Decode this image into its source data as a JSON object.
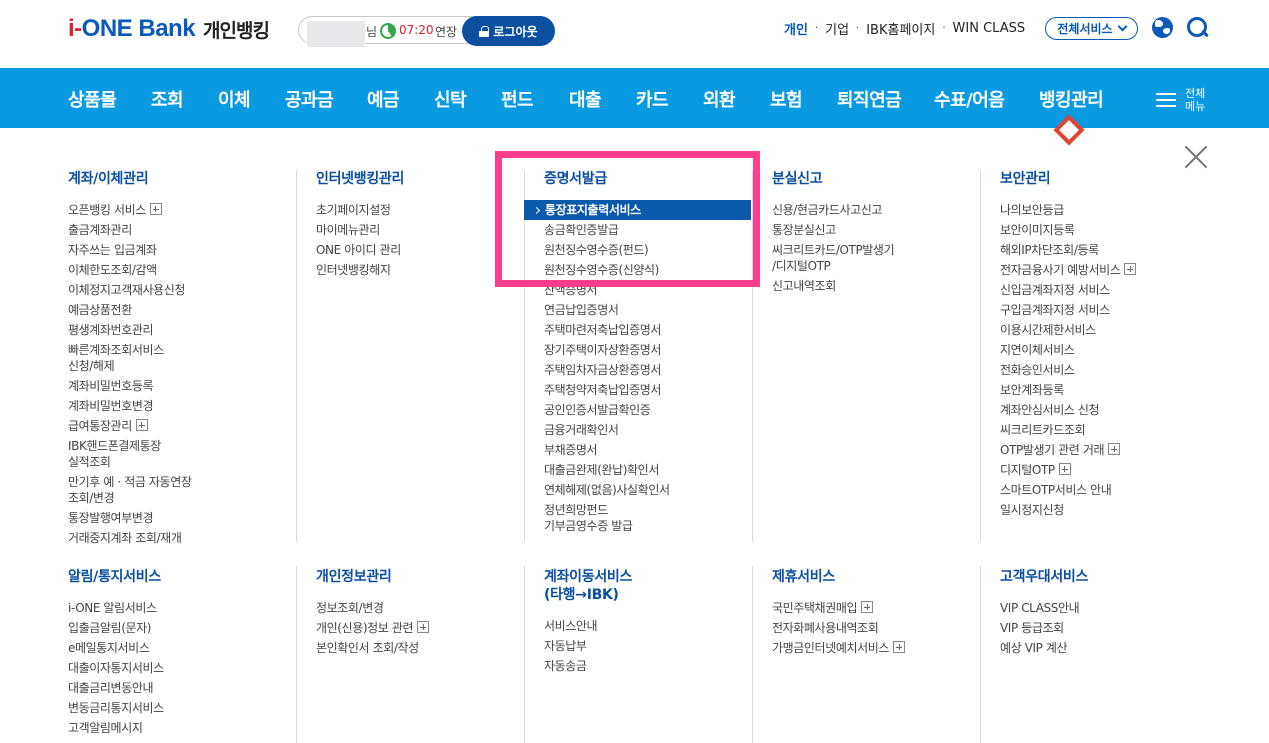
{
  "header": {
    "logo_brand_a": "i-",
    "logo_brand_b": "ONE",
    "logo_brand_c": " Bank",
    "logo_sub": "개인뱅킹",
    "session": {
      "user_suffix": "님",
      "time": "07:20",
      "extend_label": "연장",
      "logout_label": "로그아웃"
    },
    "util_links": [
      "개인",
      "기업",
      "IBK홈페이지",
      "WIN CLASS"
    ],
    "util_sep": "·",
    "all_service_label": "전체서비스"
  },
  "gnb": {
    "items": [
      "상품몰",
      "조회",
      "이체",
      "공과금",
      "예금",
      "신탁",
      "펀드",
      "대출",
      "카드",
      "외환",
      "보험",
      "퇴직연금",
      "수표/어음",
      "뱅킹관리"
    ],
    "current": "뱅킹관리",
    "menu_label_1": "전체",
    "menu_label_2": "메뉴"
  },
  "colors": {
    "brand_blue": "#0a5ab8",
    "gnb_bg": "#0a9ae2",
    "selected_bg": "#0b5aa9",
    "highlight_box": "#ff3d8f",
    "logo_red": "#e31f2d"
  },
  "menu": {
    "row1": [
      {
        "title": "계좌/이체관리",
        "items": [
          {
            "label": "오픈뱅킹 서비스",
            "plus": true
          },
          {
            "label": "출금계좌관리"
          },
          {
            "label": "자주쓰는 입금계좌"
          },
          {
            "label": "이체한도조회/감액"
          },
          {
            "label": "이체정지고객재사용신청"
          },
          {
            "label": "예금상품전환"
          },
          {
            "label": "평생계좌번호관리"
          },
          {
            "label": "빠른계좌조회서비스",
            "label2": "신청/해제"
          },
          {
            "label": "계좌비밀번호등록"
          },
          {
            "label": "계좌비밀번호변경"
          },
          {
            "label": "급여통장관리",
            "plus": true
          },
          {
            "label": "IBK핸드폰결제통장",
            "label2": "실적조회"
          },
          {
            "label": "만기후 예 · 적금 자동연장",
            "label2": "조회/변경"
          },
          {
            "label": "통장발행여부변경"
          },
          {
            "label": "거래중지계좌 조회/재개"
          }
        ]
      },
      {
        "title": "인터넷뱅킹관리",
        "items": [
          {
            "label": "초기페이지설정"
          },
          {
            "label": "마이메뉴관리"
          },
          {
            "label": "ONE 아이디 관리"
          },
          {
            "label": "인터넷뱅킹해지"
          }
        ]
      },
      {
        "title": "증명서발급",
        "items": [
          {
            "label": "통장표지출력서비스",
            "selected": true
          },
          {
            "label": "송금확인증발급"
          },
          {
            "label": "원천징수영수증(펀드)"
          },
          {
            "label": "원천징수영수증(신양식)"
          },
          {
            "label": "잔액증명서"
          },
          {
            "label": "연금납입증명서"
          },
          {
            "label": "주택마련저축납입증명서"
          },
          {
            "label": "장기주택이자상환증명서"
          },
          {
            "label": "주택임차자금상환증명서"
          },
          {
            "label": "주택청약저축납입증명서"
          },
          {
            "label": "공인인증서발급확인증"
          },
          {
            "label": "금융거래확인서"
          },
          {
            "label": "부채증명서"
          },
          {
            "label": "대출금완제(완납)확인서"
          },
          {
            "label": "연체해제(없음)사실확인서"
          },
          {
            "label": "정년희망펀드",
            "label2": "기부금영수증 발급"
          }
        ]
      },
      {
        "title": "분실신고",
        "items": [
          {
            "label": "신용/현금카드사고신고"
          },
          {
            "label": "통장분실신고"
          },
          {
            "label": "씨크리트카드/OTP발생기",
            "label2": "/디지털OTP"
          },
          {
            "label": "신고내역조회"
          }
        ]
      },
      {
        "title": "보안관리",
        "items": [
          {
            "label": "나의보안등급"
          },
          {
            "label": "보안이미지등록"
          },
          {
            "label": "해외IP차단조회/등록"
          },
          {
            "label": "전자금융사기 예방서비스",
            "plus": true
          },
          {
            "label": "신입금계좌지정 서비스"
          },
          {
            "label": "구입금계좌지정 서비스"
          },
          {
            "label": "이용시간제한서비스"
          },
          {
            "label": "지연이체서비스"
          },
          {
            "label": "전화승인서비스"
          },
          {
            "label": "보안계좌등록"
          },
          {
            "label": "계좌안심서비스 신청"
          },
          {
            "label": "씨크리트카드조회"
          },
          {
            "label": "OTP발생기 관련 거래",
            "plus": true
          },
          {
            "label": "디지털OTP",
            "plus": true
          },
          {
            "label": "스마트OTP서비스 안내"
          },
          {
            "label": "일시정지신청"
          }
        ]
      }
    ],
    "row2": [
      {
        "title": "알림/통지서비스",
        "items": [
          {
            "label": "i-ONE 알림서비스"
          },
          {
            "label": "입출금알림(문자)"
          },
          {
            "label": "e메일통지서비스"
          },
          {
            "label": "대출이자통지서비스"
          },
          {
            "label": "대출금리변동안내"
          },
          {
            "label": "변동금리통지서비스"
          },
          {
            "label": "고객알림메시지"
          }
        ]
      },
      {
        "title": "개인정보관리",
        "items": [
          {
            "label": "정보조회/변경"
          },
          {
            "label": "개인(신용)정보 관련",
            "plus": true
          },
          {
            "label": "본인확인서 조회/작성"
          }
        ]
      },
      {
        "title": "계좌이동서비스",
        "title2": "(타행→IBK)",
        "items": [
          {
            "label": "서비스안내"
          },
          {
            "label": "자동납부"
          },
          {
            "label": "자동송금"
          }
        ]
      },
      {
        "title": "제휴서비스",
        "items": [
          {
            "label": "국민주택채권매입",
            "plus": true
          },
          {
            "label": "전자화폐사용내역조회"
          },
          {
            "label": "가맹금인터넷예치서비스",
            "plus": true
          }
        ]
      },
      {
        "title": "고객우대서비스",
        "items": [
          {
            "label": "VIP CLASS안내"
          },
          {
            "label": "VIP 등급조회"
          },
          {
            "label": "예상 VIP 계산"
          }
        ]
      }
    ]
  }
}
